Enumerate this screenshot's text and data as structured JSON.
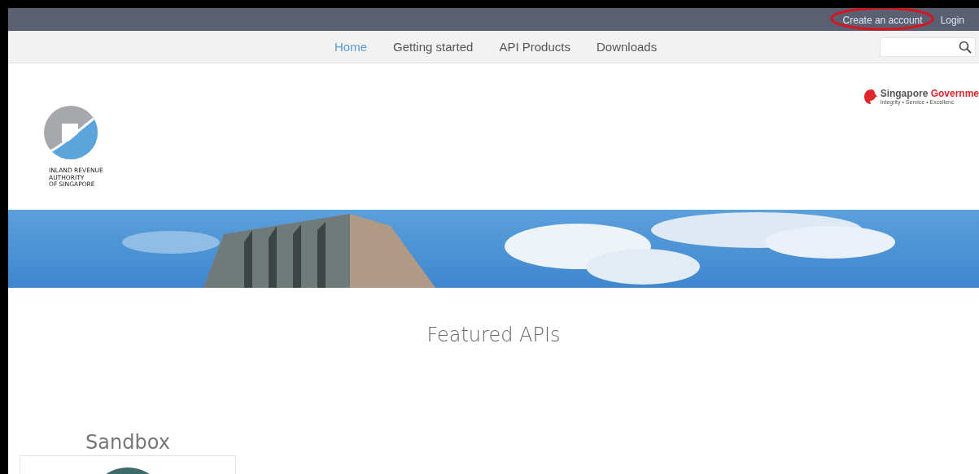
{
  "top_bar": {
    "links": [
      {
        "label": "Create an account",
        "highlighted": true
      },
      {
        "label": "Login",
        "highlighted": false
      }
    ]
  },
  "nav": {
    "items": [
      {
        "label": "Home",
        "selected": true
      },
      {
        "label": "Getting started",
        "selected": false
      },
      {
        "label": "API Products",
        "selected": false
      },
      {
        "label": "Downloads",
        "selected": false
      }
    ]
  },
  "header": {
    "agency_logo": {
      "lines": [
        "INLAND REVENUE",
        "AUTHORITY",
        "OF SINGAPORE"
      ]
    },
    "gov_logo": {
      "name": "Singapore",
      "name_accent": "Governme",
      "tagline": "Integrity • Service • Excellenc"
    }
  },
  "featured": {
    "title": "Featured APIs"
  },
  "products": [
    {
      "title": "Sandbox"
    }
  ]
}
